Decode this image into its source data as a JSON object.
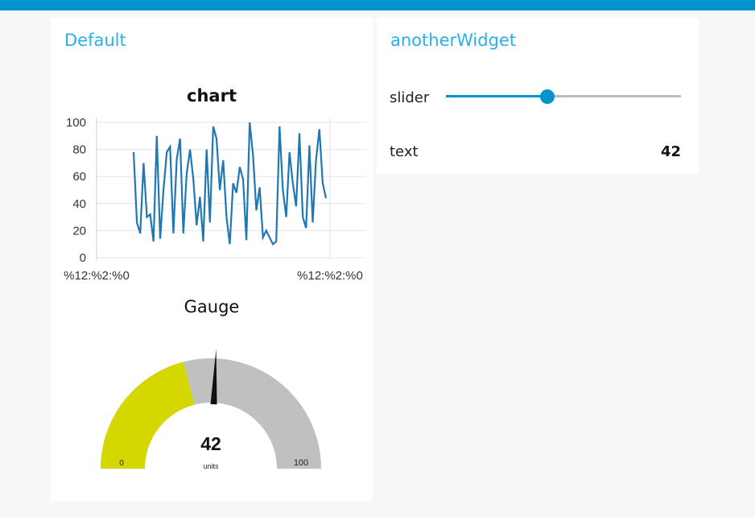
{
  "colors": {
    "header_bar": "#0094ce",
    "group_title": "#2ab0e8",
    "chart_line": "#1f77b4",
    "gauge_value": "#d4d800",
    "gauge_rest": "#c0c0c0",
    "slider_active": "#0094ce",
    "slider_rest": "#bdbdbd"
  },
  "groups": {
    "default": {
      "title": "Default"
    },
    "another": {
      "title": "anotherWidget"
    }
  },
  "chart": {
    "title": "chart"
  },
  "chart_data": {
    "type": "line",
    "title": "chart",
    "xlabel": "",
    "ylabel": "",
    "ylim": [
      0,
      100
    ],
    "y_ticks": [
      "100",
      "80",
      "60",
      "40",
      "20",
      "0"
    ],
    "x_tick_labels": [
      "%12:%2:%0",
      "%12:%2:%0"
    ],
    "grid": true,
    "series": [
      {
        "values": [
          78,
          26,
          18,
          70,
          30,
          32,
          12,
          90,
          14,
          50,
          78,
          82,
          18,
          73,
          88,
          18,
          62,
          80,
          58,
          24,
          45,
          12,
          80,
          26,
          97,
          88,
          50,
          72,
          30,
          10,
          55,
          48,
          67,
          58,
          13,
          100,
          76,
          35,
          52,
          15,
          20,
          15,
          10,
          12,
          97,
          50,
          30,
          78,
          55,
          38,
          92,
          30,
          22,
          83,
          26,
          72,
          95,
          55,
          44
        ]
      }
    ]
  },
  "gauge": {
    "title": "Gauge",
    "value": 42,
    "value_text": "42",
    "units": "units",
    "min": 0,
    "max": 100,
    "min_label": "0",
    "max_label": "100"
  },
  "slider": {
    "label": "slider",
    "value_fraction": 0.43
  },
  "text_widget": {
    "label": "text",
    "value": "42"
  }
}
